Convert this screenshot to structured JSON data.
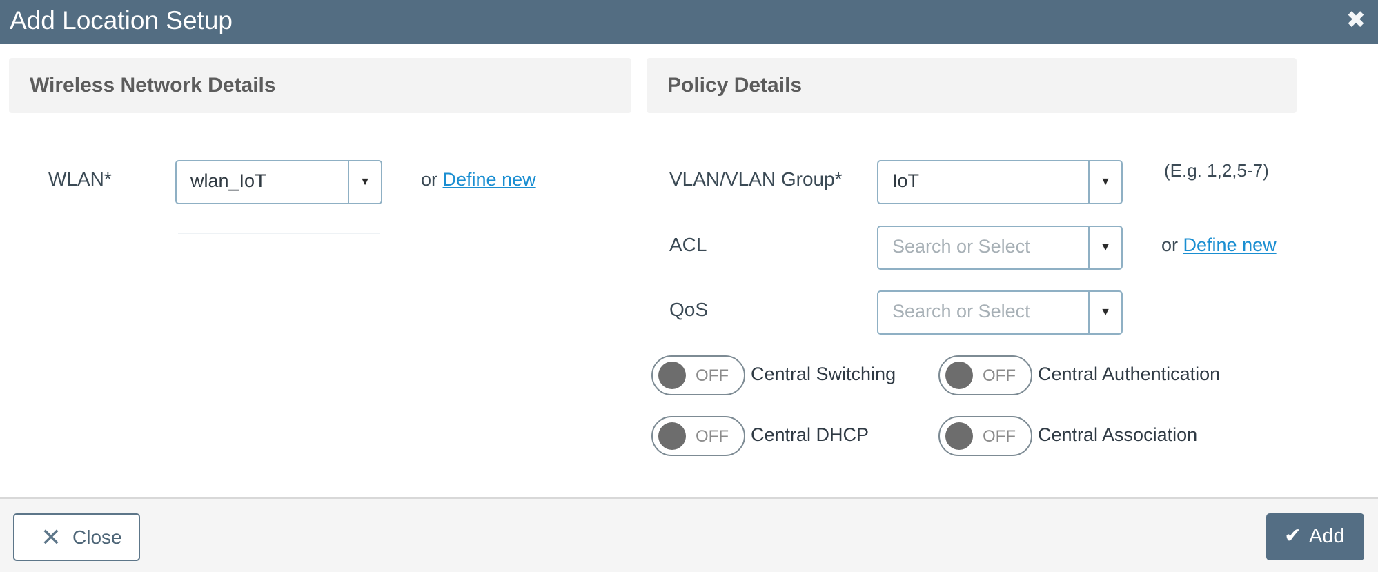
{
  "dialog": {
    "title": "Add Location Setup",
    "close_icon": "close-icon"
  },
  "wireless": {
    "header": "Wireless Network Details",
    "wlan_label": "WLAN*",
    "wlan_value": "wlan_IoT",
    "or_text": "or",
    "define_new": "Define new"
  },
  "policy": {
    "header": "Policy Details",
    "vlan_label": "VLAN/VLAN Group*",
    "vlan_value": "IoT",
    "vlan_hint": "(E.g. 1,2,5-7)",
    "acl_label": "ACL",
    "acl_placeholder": "Search or Select",
    "acl_or_text": "or",
    "acl_define_new": "Define new",
    "qos_label": "QoS",
    "qos_placeholder": "Search or Select"
  },
  "toggles": [
    {
      "label": "Central Switching",
      "state": "OFF"
    },
    {
      "label": "Central Authentication",
      "state": "OFF"
    },
    {
      "label": "Central DHCP",
      "state": "OFF"
    },
    {
      "label": "Central Association",
      "state": "OFF"
    }
  ],
  "footer": {
    "close_label": "Close",
    "add_label": "Add"
  },
  "colors": {
    "titlebar": "#536d82",
    "link": "#1a8ed1",
    "add_button": "#546e84"
  }
}
